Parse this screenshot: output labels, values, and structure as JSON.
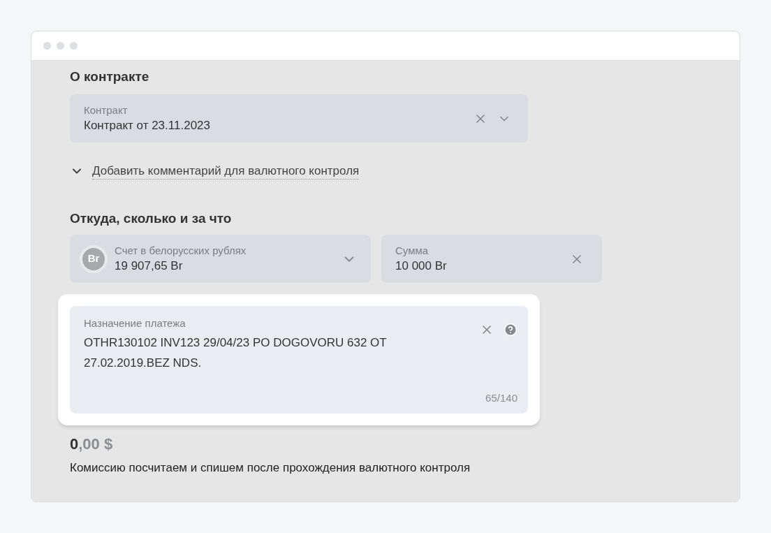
{
  "contract_section": {
    "title": "О контракте",
    "contract_field": {
      "label": "Контракт",
      "value": "Контракт от 23.11.2023"
    },
    "comment_toggle": {
      "label": "Добавить комментарий для валютного контроля",
      "expanded": false
    }
  },
  "payment_section": {
    "title": "Откуда, сколько и за что",
    "account_field": {
      "badge": "Br",
      "label": "Счет в белорусских рублях",
      "value": "19 907,65 Br"
    },
    "amount_field": {
      "label": "Сумма",
      "value": "10 000 Br"
    },
    "purpose_field": {
      "label": "Назначение платежа",
      "value": "OTHR130102 INV123 29/04/23 PO DOGOVORU 632 OT 27.02.2019.BEZ NDS.",
      "counter": "65/140",
      "highlighted": true
    }
  },
  "fee": {
    "integer": "0",
    "fraction": ",00 $",
    "note": "Комиссию посчитаем и спишем после прохождения валютного контроля"
  }
}
